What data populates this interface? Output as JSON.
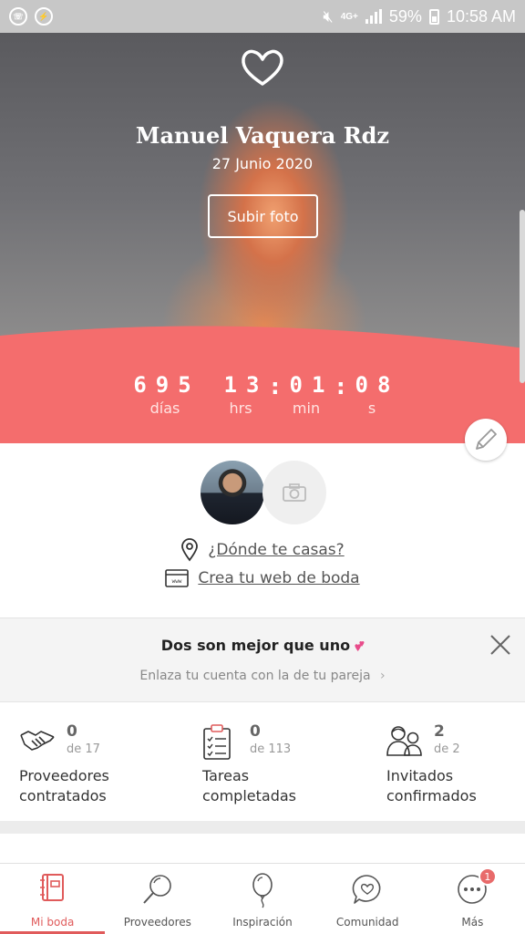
{
  "status_bar": {
    "apps": [
      "whatsapp-icon",
      "messenger-icon"
    ],
    "network": "4G+",
    "battery": "59%",
    "time": "10:58 AM"
  },
  "hero": {
    "name": "Manuel Vaquera Rdz",
    "date": "27 Junio 2020",
    "upload_label": "Subir foto"
  },
  "countdown": {
    "days": "695",
    "days_label": "días",
    "hours": "13",
    "hours_label": "hrs",
    "minutes": "01",
    "minutes_label": "min",
    "seconds": "08",
    "seconds_label": "s"
  },
  "profile": {
    "location_link": "¿Dónde te casas?",
    "web_link": "Crea tu web de boda"
  },
  "banner": {
    "title": "Dos son mejor que uno",
    "subtitle": "Enlaza tu cuenta con la de tu pareja"
  },
  "stats": [
    {
      "icon": "handshake-icon",
      "value": "0",
      "of": "de 17",
      "label1": "Proveedores",
      "label2": "contratados"
    },
    {
      "icon": "checklist-icon",
      "value": "0",
      "of": "de 113",
      "label1": "Tareas",
      "label2": "completadas"
    },
    {
      "icon": "guests-icon",
      "value": "2",
      "of": "de 2",
      "label1": "Invitados",
      "label2": "confirmados"
    }
  ],
  "nav": [
    {
      "icon": "notebook-icon",
      "label": "Mi boda",
      "active": true
    },
    {
      "icon": "search-icon",
      "label": "Proveedores"
    },
    {
      "icon": "balloon-icon",
      "label": "Inspiración"
    },
    {
      "icon": "chat-heart-icon",
      "label": "Comunidad"
    },
    {
      "icon": "more-icon",
      "label": "Más",
      "badge": "1"
    }
  ],
  "colors": {
    "accent": "#f46d6d",
    "nav_active": "#e05b5b"
  }
}
